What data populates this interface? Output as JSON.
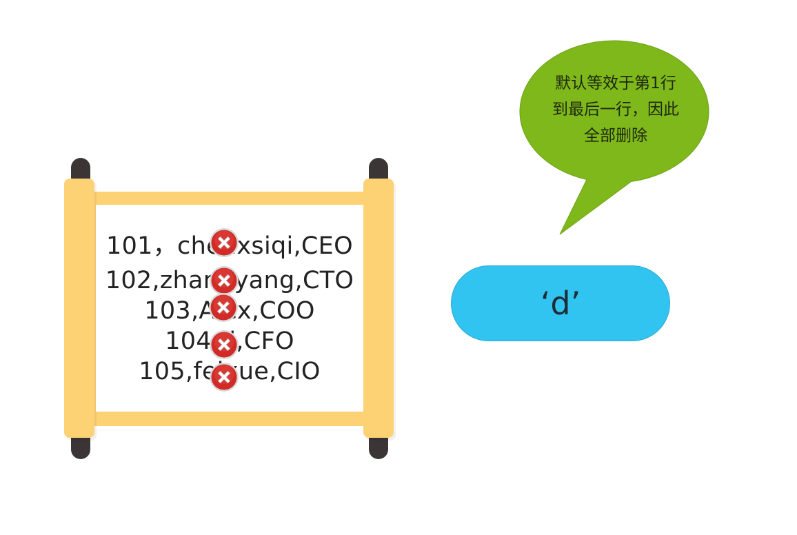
{
  "records": [
    {
      "text": "101，chenxsiqi,CEO"
    },
    {
      "text": "102,zhangyang,CTO"
    },
    {
      "text": "103,Alex,COO"
    },
    {
      "text": "104,ti,CFO"
    },
    {
      "text": "105,feixue,CIO"
    }
  ],
  "bubble": {
    "lines": [
      "默认等效于第1行",
      "到最后一行，因此",
      "全部删除"
    ],
    "color": "#7fb81a"
  },
  "command": {
    "label": "‘d’",
    "color": "#31c4f0"
  },
  "colors": {
    "scroll_paper": "#fdd274",
    "scroll_knob": "#3b3635",
    "delete_mark": "#d02b26"
  },
  "icons": {
    "delete": "red-x-circle-icon"
  }
}
